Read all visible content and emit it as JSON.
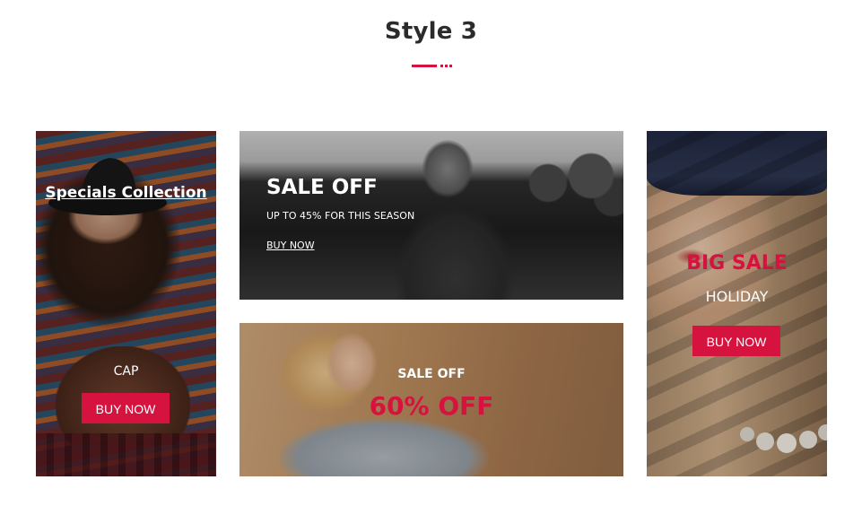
{
  "section": {
    "title": "Style 3",
    "accent_color": "#d6133e"
  },
  "banners": {
    "left": {
      "title": "Specials Collection",
      "label": "CAP",
      "button": "BUY NOW"
    },
    "top": {
      "title": "SALE OFF",
      "subtitle": "UP TO 45% FOR THIS SEASON",
      "link": "BUY NOW"
    },
    "bottom": {
      "subtitle": "SALE OFF",
      "headline": "60% OFF"
    },
    "right": {
      "title": "BIG SALE",
      "subtitle": "HOLIDAY",
      "button": "BUY NOW"
    }
  }
}
